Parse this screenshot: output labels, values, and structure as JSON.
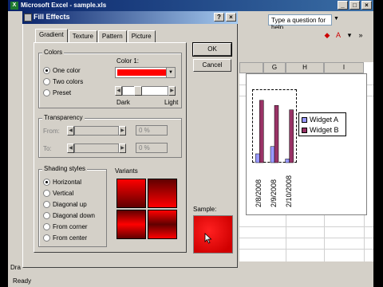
{
  "excel": {
    "title": "Microsoft Excel - sample.xls",
    "help_placeholder": "Type a question for help",
    "status": "Ready",
    "sheet_tab": "Dra",
    "columns": [
      "G",
      "H",
      "I"
    ]
  },
  "dialog": {
    "title": "Fill Effects",
    "tabs": [
      "Gradient",
      "Texture",
      "Pattern",
      "Picture"
    ],
    "ok_label": "OK",
    "cancel_label": "Cancel",
    "colors": {
      "group_title": "Colors",
      "options": [
        "One color",
        "Two colors",
        "Preset"
      ],
      "selected": "One color",
      "color1_label": "Color 1:",
      "color1_value": "#ff0000",
      "dark_label": "Dark",
      "light_label": "Light"
    },
    "transparency": {
      "group_title": "Transparency",
      "from_label": "From:",
      "to_label": "To:",
      "from_value": "0 %",
      "to_value": "0 %"
    },
    "shading": {
      "group_title": "Shading styles",
      "options": [
        "Horizontal",
        "Vertical",
        "Diagonal up",
        "Diagonal down",
        "From corner",
        "From center"
      ],
      "selected": "Horizontal"
    },
    "variants_label": "Variants",
    "sample_label": "Sample:"
  },
  "chart_data": {
    "type": "bar",
    "categories": [
      "2/8/2008",
      "2/9/2008",
      "2/10/2008"
    ],
    "series": [
      {
        "name": "Widget A",
        "color": "#9999ff",
        "values": [
          12,
          22,
          5
        ]
      },
      {
        "name": "Widget B",
        "color": "#993366",
        "values": [
          85,
          78,
          72
        ]
      }
    ],
    "ylim": [
      0,
      100
    ],
    "legend": "right"
  }
}
